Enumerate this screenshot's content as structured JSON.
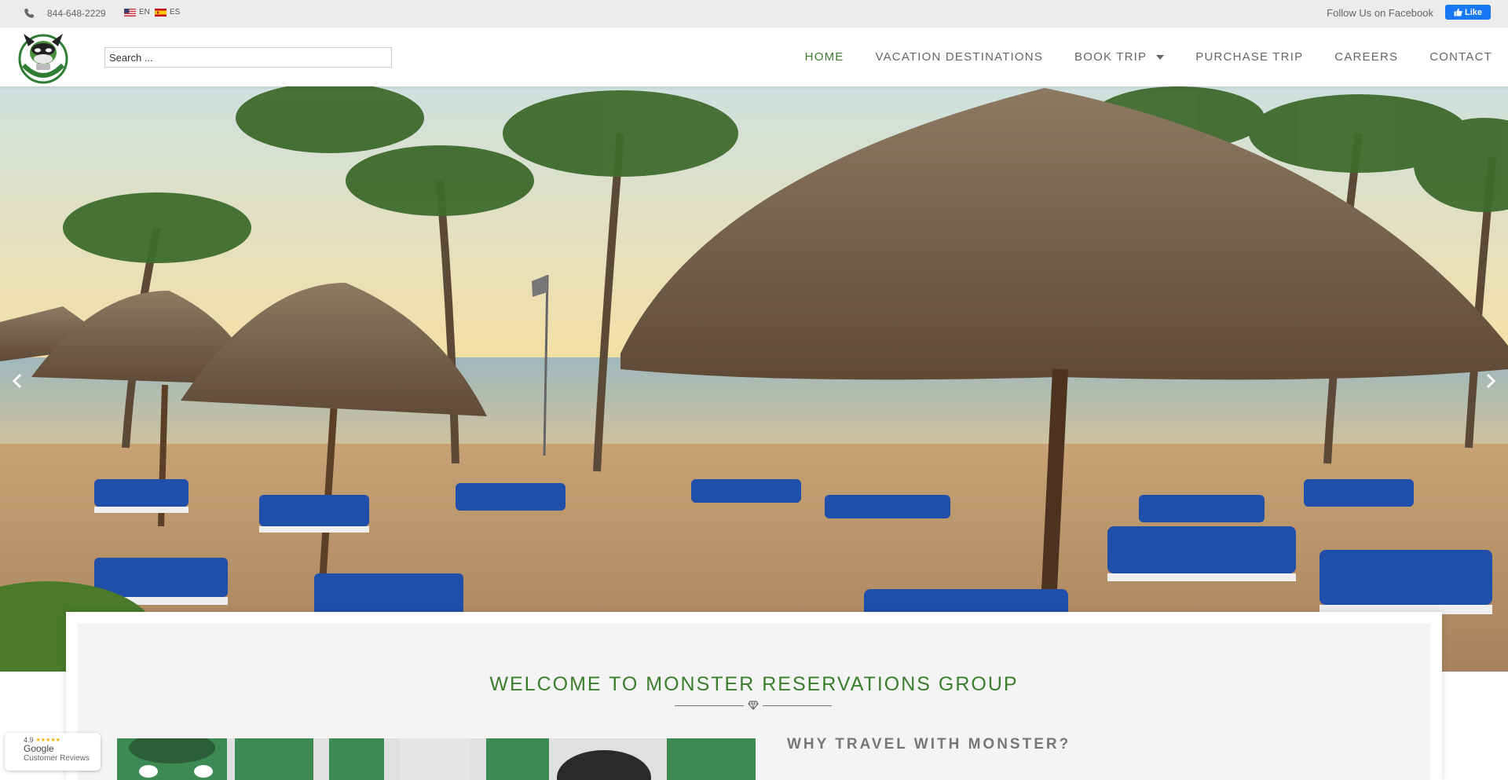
{
  "topbar": {
    "phone": "844-648-2229",
    "lang_en": "EN",
    "lang_es": "ES",
    "follow_text": "Follow Us on Facebook",
    "fb_like_label": "Like"
  },
  "header": {
    "search_placeholder": "Search ...",
    "nav": {
      "home": "HOME",
      "vacation": "VACATION DESTINATIONS",
      "book_trip": "BOOK TRIP",
      "purchase": "PURCHASE TRIP",
      "careers": "CAREERS",
      "contact": "CONTACT"
    }
  },
  "content": {
    "welcome_title": "WELCOME TO MONSTER RESERVATIONS GROUP",
    "why_title": "WHY TRAVEL WITH MONSTER?"
  },
  "google_badge": {
    "rating": "4.9",
    "stars": "★★★★★",
    "name": "Google",
    "subtitle": "Customer Reviews"
  },
  "colors": {
    "accent_green": "#3a7d2c",
    "topbar_bg": "#ececec",
    "facebook_blue": "#1877f2"
  },
  "icons": [
    "phone-icon",
    "us-flag-icon",
    "spain-flag-icon",
    "facebook-thumb-icon",
    "logo-icon",
    "chevron-down-icon",
    "chevron-left-icon",
    "chevron-right-icon",
    "diamond-icon"
  ]
}
